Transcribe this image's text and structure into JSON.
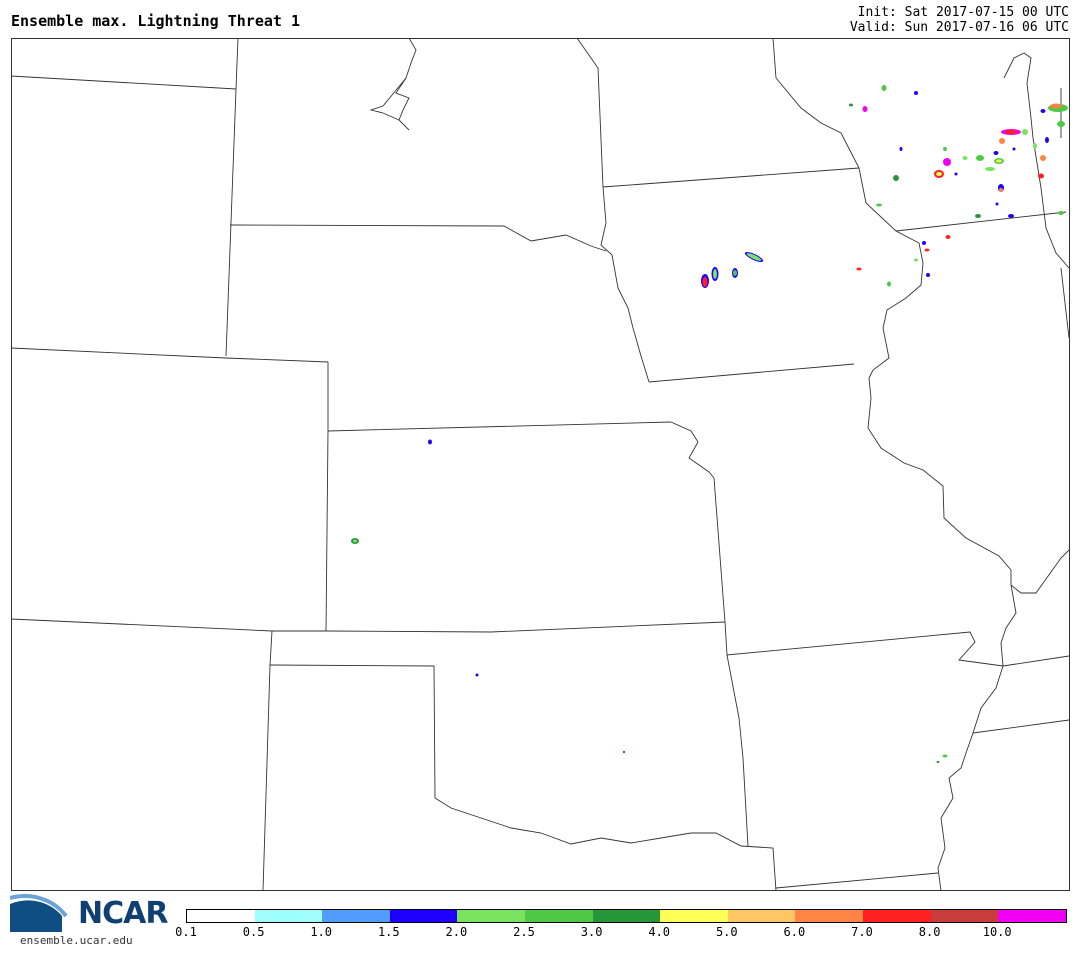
{
  "header": {
    "title": "Ensemble max. Lightning Threat 1",
    "init": "Init: Sat 2017-07-15 00 UTC",
    "valid": "Valid: Sun 2017-07-16 06 UTC"
  },
  "logo": {
    "text": "NCAR",
    "url_text": "ensemble.ucar.edu"
  },
  "colorbar": {
    "colors": [
      "#ffffff",
      "#9ffffd",
      "#519cff",
      "#1f00ff",
      "#78e35f",
      "#4ec945",
      "#27963a",
      "#feff57",
      "#ffc764",
      "#ff8544",
      "#ff2020",
      "#c83c3c",
      "#f000f2"
    ],
    "labels": [
      "0.1",
      "0.5",
      "1.0",
      "1.5",
      "2.0",
      "2.5",
      "3.0",
      "4.0",
      "5.0",
      "6.0",
      "7.0",
      "8.0",
      "10.0"
    ]
  }
}
